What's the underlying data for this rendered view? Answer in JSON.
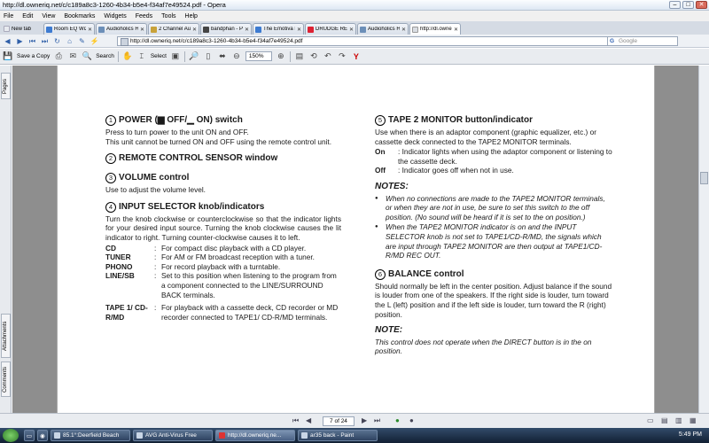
{
  "window": {
    "title": "http://dl.owneriq.net/c/c189a8c3-1260-4b34-b5e4-f34af7e49524.pdf - Opera"
  },
  "menu": [
    "File",
    "Edit",
    "View",
    "Bookmarks",
    "Widgets",
    "Feeds",
    "Tools",
    "Help"
  ],
  "tabs": [
    {
      "label": "New tab",
      "color": "#d9dde3"
    },
    {
      "label": "Room EQ Wizard Ho...",
      "color": "#3d7bd1"
    },
    {
      "label": "Audioholics Home T...",
      "color": "#6c8fb8"
    },
    {
      "label": "2 Channel Audio - A...",
      "color": "#c8a23a"
    },
    {
      "label": "bandphan - Photob...",
      "color": "#444"
    },
    {
      "label": "The Emotiva Lounge...",
      "color": "#3d7bd1"
    },
    {
      "label": "DRUDGE REPORT 20...",
      "color": "#d23"
    },
    {
      "label": "Audioholics Home T...",
      "color": "#6c8fb8"
    },
    {
      "label": "http://dl.owneriq.ne...",
      "color": "#d9dde3"
    }
  ],
  "address": {
    "url": "http://dl.owneriq.net/c/c189a8c3-1260-4b34-b5e4-f34af7e49524.pdf",
    "search_placeholder": "Google"
  },
  "pdf_toolbar": {
    "save_copy": "Save a Copy",
    "search": "Search",
    "select": "Select",
    "zoom": "150%"
  },
  "side_tabs": {
    "pages": "Pages",
    "attachments": "Attachments",
    "comments": "Comments"
  },
  "doc": {
    "s1": {
      "num": "1",
      "title": "POWER (▆ OFF/▁ ON) switch",
      "p1": "Press to turn power to the unit ON and OFF.",
      "p2": "This unit cannot be turned ON and OFF using the remote control unit."
    },
    "s2": {
      "num": "2",
      "title": "REMOTE CONTROL SENSOR window"
    },
    "s3": {
      "num": "3",
      "title": "VOLUME control",
      "p1": "Use to adjust the volume level."
    },
    "s4": {
      "num": "4",
      "title": "INPUT SELECTOR knob/indicators",
      "p1": "Turn the knob clockwise or counterclockwise so that the indicator lights for your desired input source. Turning the knob clockwise causes the lit indicator to right. Turning counter-clockwise causes it to left.",
      "defs": [
        {
          "k": "CD",
          "v": "For compact disc playback with a CD player."
        },
        {
          "k": "TUNER",
          "v": "For AM or FM broadcast reception with a tuner."
        },
        {
          "k": "PHONO",
          "v": "For record playback with a turntable."
        },
        {
          "k": "LINE/SB",
          "v": "Set to this position when listening to the program from a component connected to the LINE/SURROUND BACK terminals."
        },
        {
          "k": "TAPE 1/ CD-R/MD",
          "v": "For playback with a cassette deck, CD recorder or MD recorder connected to TAPE1/ CD-R/MD terminals."
        }
      ]
    },
    "s5": {
      "num": "5",
      "title": "TAPE 2 MONITOR button/indicator",
      "p1": "Use when there is an adaptor component (graphic equalizer, etc.) or cassette deck connected to the TAPE2 MONITOR terminals.",
      "defs": [
        {
          "k": "On",
          "v": ": Indicator lights when using the adaptor component or listening to the cassette deck."
        },
        {
          "k": "Off",
          "v": ": Indicator goes off when not in use."
        }
      ],
      "notes_title": "NOTES:",
      "notes": [
        "When no connections are made to the TAPE2 MONITOR terminals, or when they are not in use, be sure to set this switch to the off position. (No sound will be heard if it is set to the on position.)",
        "When the TAPE2 MONITOR indicator is on and the INPUT SELECTOR knob is not set to TAPE1/CD-R/MD, the signals which are input through TAPE2 MONITOR are then output at TAPE1/CD-R/MD REC OUT."
      ]
    },
    "s6": {
      "num": "6",
      "title": "BALANCE control",
      "p1": "Should normally be left in the center position. Adjust balance if the sound is louder from one of the speakers. If the right side is louder, turn toward the L (left) position and if the left side is louder, turn toward the R (right) position.",
      "note_title": "NOTE:",
      "note": "This control does not operate when the DIRECT button is in the on position."
    }
  },
  "status": {
    "page": "7 of 24"
  },
  "taskbar": [
    {
      "label": "85.1°:Deerfield Beach"
    },
    {
      "label": "AVG Anti-Virus Free"
    },
    {
      "label": "http://dl.owneriq.ne..."
    },
    {
      "label": "ar35 back - Paint"
    }
  ],
  "clock": "5:49 PM"
}
